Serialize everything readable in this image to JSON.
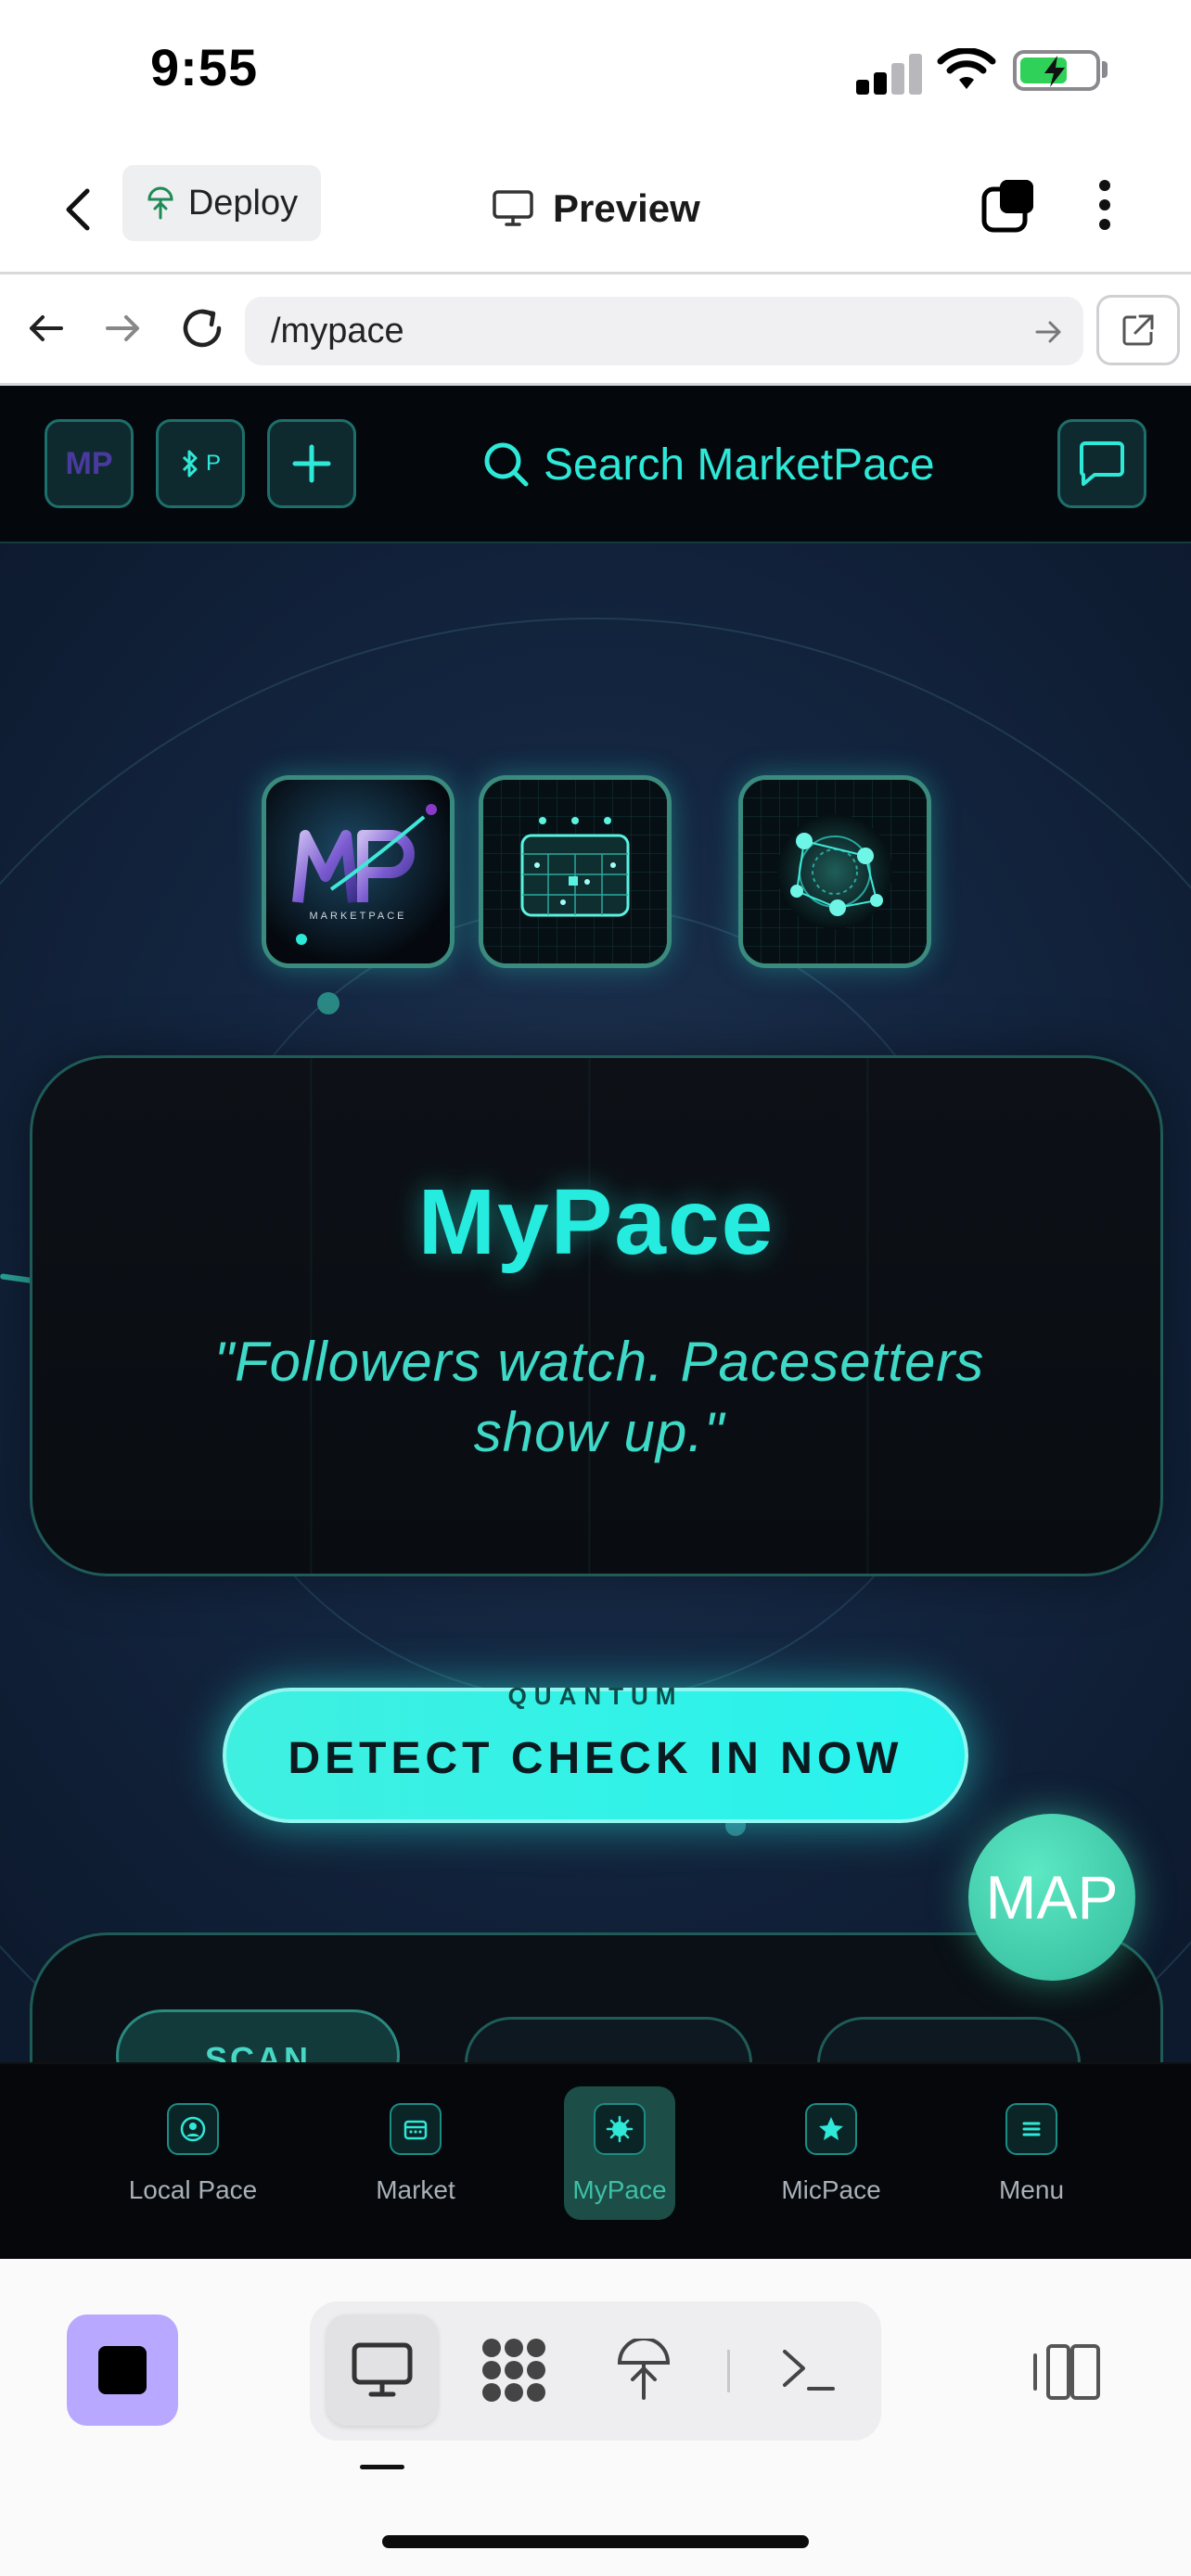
{
  "status_bar": {
    "time": "9:55"
  },
  "header": {
    "deploy_label": "Deploy",
    "title": "Preview"
  },
  "browser": {
    "url": "/mypace"
  },
  "app": {
    "top_nav": {
      "logo_text": "MP",
      "bluetooth_badge": "P",
      "search_placeholder": "Search MarketPace"
    },
    "tiles": {
      "logo_caption": "MARKETPACE"
    },
    "hero": {
      "title": "MyPace",
      "quote": "\"Followers watch. Pacesetters show up.\""
    },
    "cta": {
      "overline": "QUANTUM",
      "label": "DETECT CHECK IN NOW"
    },
    "map_button": "MAP",
    "lower_panel": {
      "first_button": "SCAN"
    },
    "bottom_tabs": [
      {
        "label": "Local Pace",
        "icon": "person-circle-icon"
      },
      {
        "label": "Market",
        "icon": "store-icon"
      },
      {
        "label": "MyPace",
        "icon": "spark-icon",
        "active": true
      },
      {
        "label": "MicPace",
        "icon": "star-icon"
      },
      {
        "label": "Menu",
        "icon": "menu-icon"
      }
    ]
  },
  "colors": {
    "accent": "#25ecdf",
    "background": "#142641",
    "active_tab": "#1c4d46",
    "stop_button": "#b9a8ff"
  }
}
